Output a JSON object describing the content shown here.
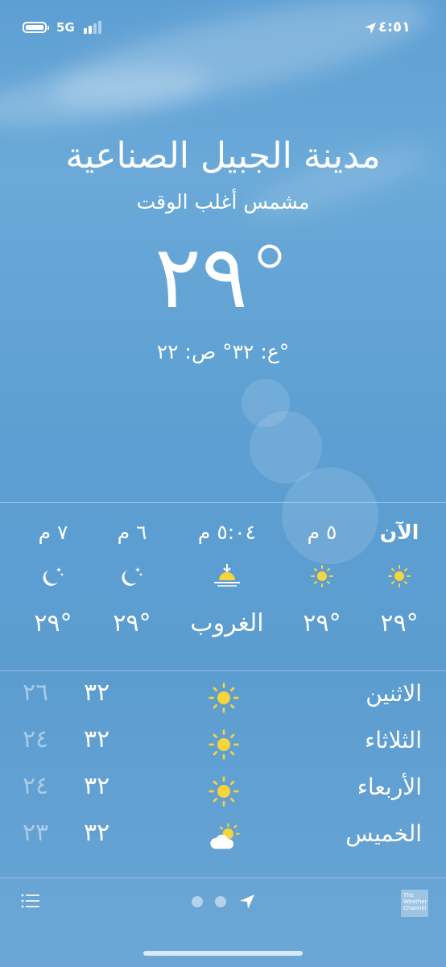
{
  "status_bar": {
    "network": "5G",
    "time": "٤:٥١"
  },
  "location": {
    "city": "مدينة الجبيل الصناعية",
    "condition": "مشمس أغلب الوقت",
    "temperature": "٢٩°",
    "high_low": "ع: ٣٢° ص: ٢٢°"
  },
  "hourly": [
    {
      "label": "الآن",
      "icon": "sun-icon",
      "temp": "٢٩°"
    },
    {
      "label": "٥ م",
      "icon": "sun-icon",
      "temp": "٢٩°"
    },
    {
      "label": "٥:٠٤ م",
      "icon": "sunset-icon",
      "temp": "الغروب"
    },
    {
      "label": "٦ م",
      "icon": "moon-stars-icon",
      "temp": "٢٩°"
    },
    {
      "label": "٧ م",
      "icon": "moon-stars-icon",
      "temp": "٢٩°"
    }
  ],
  "daily": [
    {
      "day": "الاثنين",
      "icon": "sun-icon",
      "high": "٣٢",
      "low": "٢٦"
    },
    {
      "day": "الثلاثاء",
      "icon": "sun-icon",
      "high": "٣٢",
      "low": "٢٤"
    },
    {
      "day": "الأربعاء",
      "icon": "sun-icon",
      "high": "٣٢",
      "low": "٢٤"
    },
    {
      "day": "الخميس",
      "icon": "partly-cloudy-icon",
      "high": "٣٢",
      "low": "٢٣"
    }
  ],
  "bottom_bar": {
    "brand": "The Weather Channel"
  },
  "colors": {
    "sun": "#f7d33c",
    "sky": "#5e9fd3"
  }
}
